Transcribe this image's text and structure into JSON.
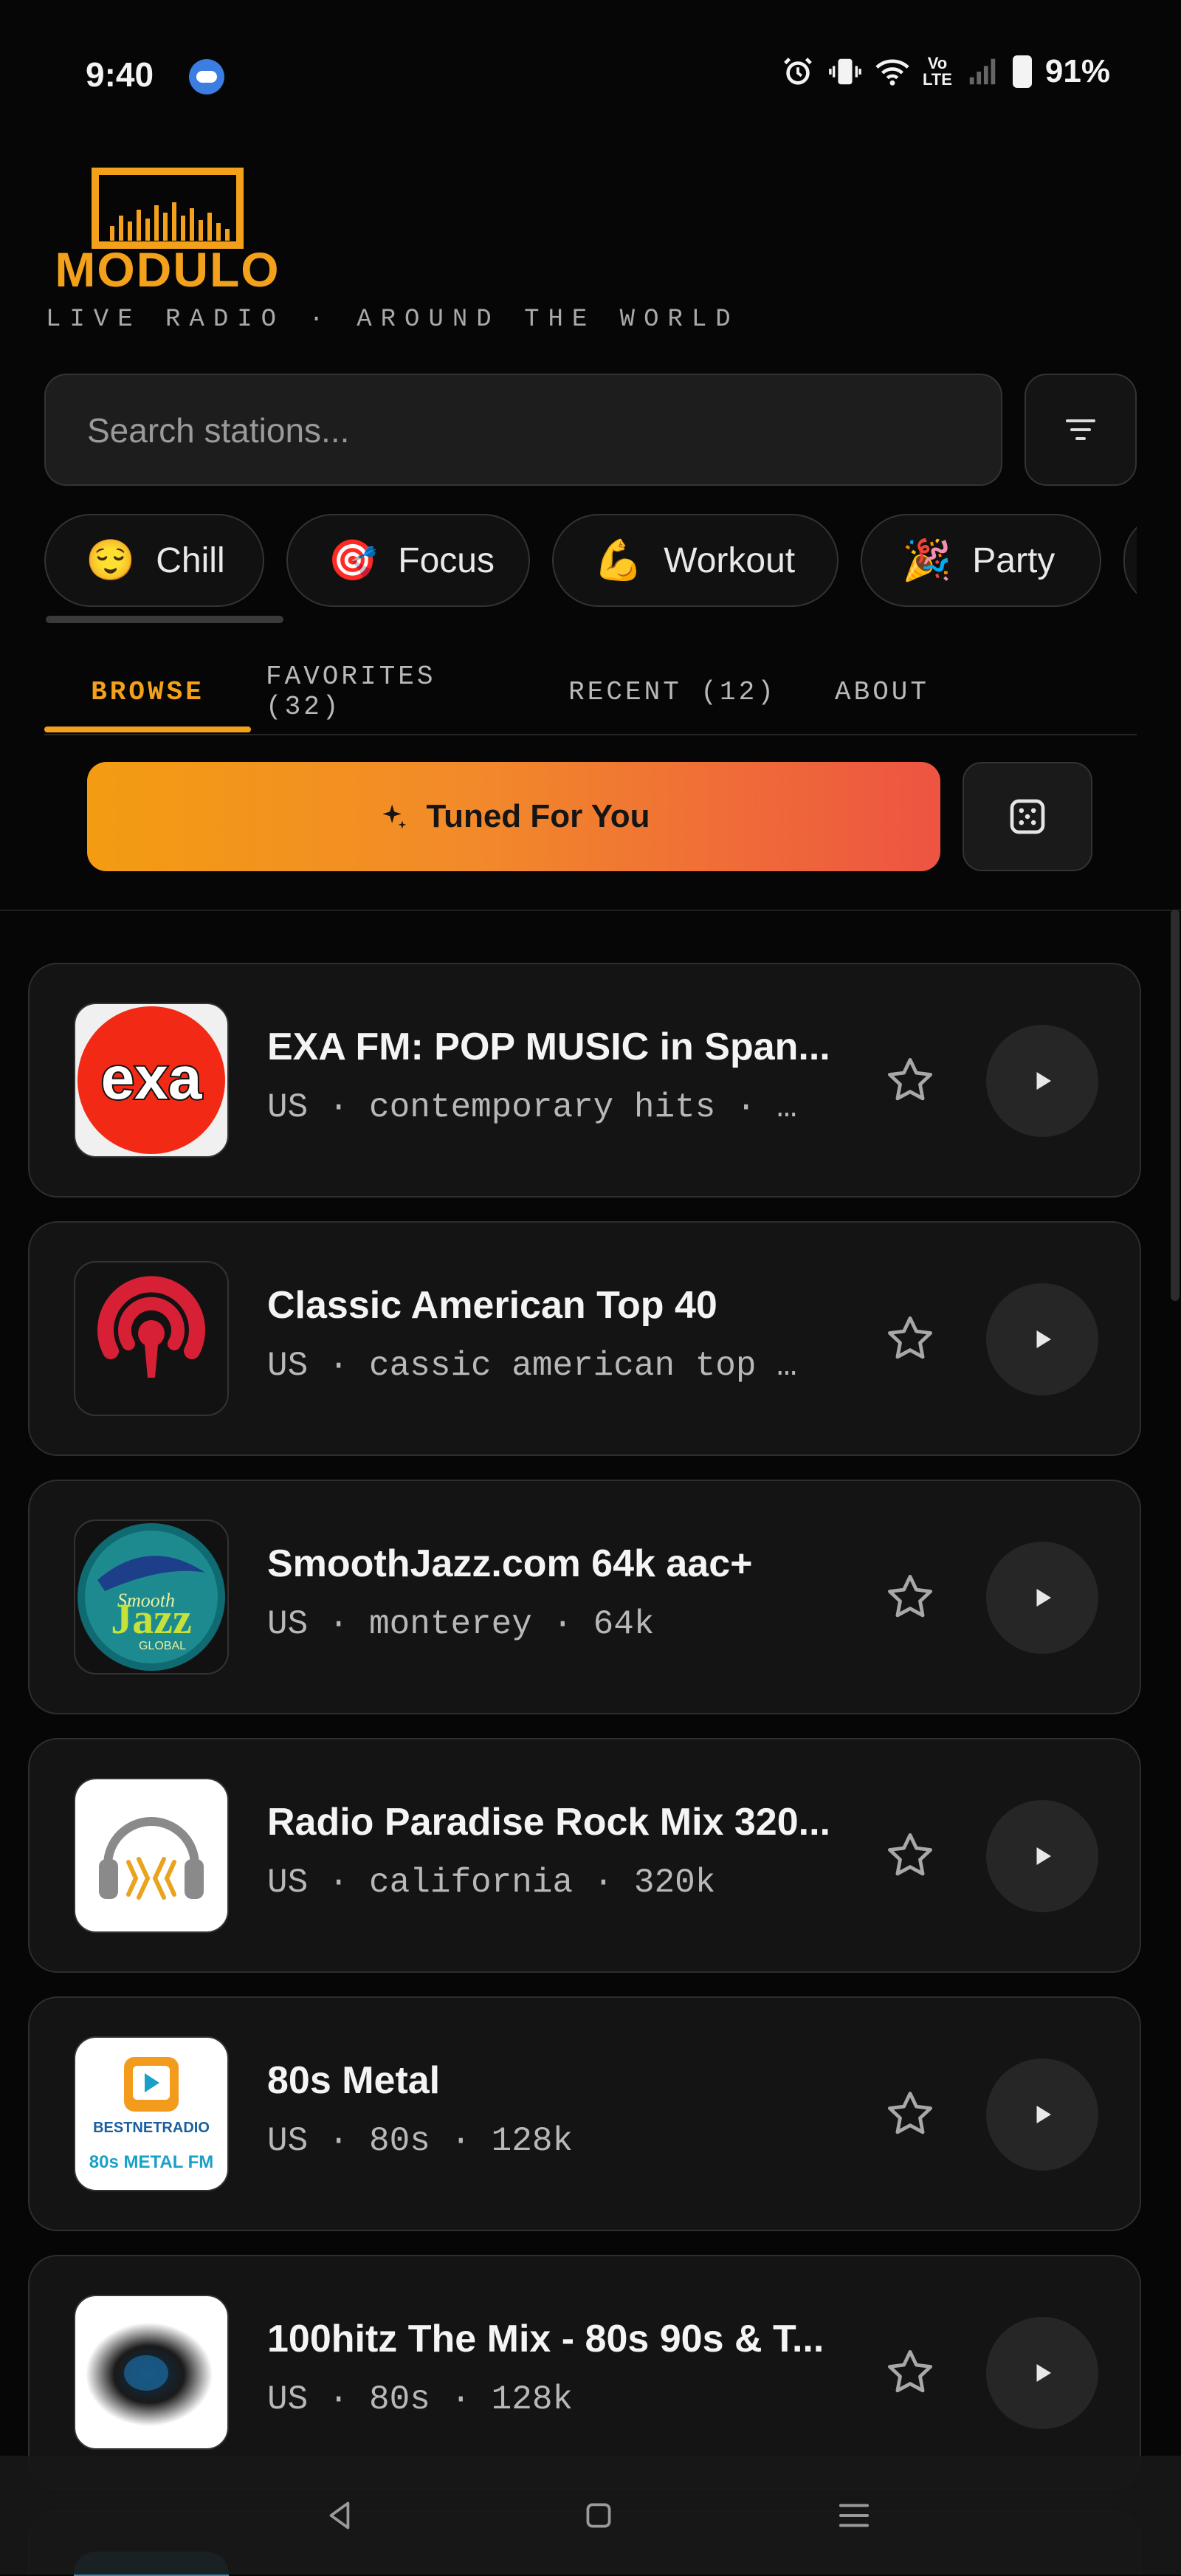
{
  "status_bar": {
    "time": "9:40",
    "battery": "91%",
    "lte_label_top": "Vo",
    "lte_label_bottom": "LTE"
  },
  "brand": {
    "logo_text": "MODULO",
    "tagline": "LIVE RADIO · AROUND THE WORLD",
    "accent_color": "#f3a11b"
  },
  "search": {
    "placeholder": "Search stations...",
    "value": ""
  },
  "moods": [
    {
      "emoji": "😌",
      "label": "Chill"
    },
    {
      "emoji": "🎯",
      "label": "Focus"
    },
    {
      "emoji": "💪",
      "label": "Workout"
    },
    {
      "emoji": "🎉",
      "label": "Party"
    }
  ],
  "tabs": [
    {
      "label": "BROWSE",
      "active": true
    },
    {
      "label": "FAVORITES (32)",
      "active": false
    },
    {
      "label": "RECENT (12)",
      "active": false
    },
    {
      "label": "ABOUT",
      "active": false
    }
  ],
  "tuned": {
    "label": "Tuned For You",
    "icon": "sparkle-icon"
  },
  "stations": [
    {
      "name": "EXA FM: POP MUSIC in Span...",
      "meta": "US · contemporary hits · …",
      "logo": "exa"
    },
    {
      "name": "Classic American Top 40",
      "meta": "US · cassic american top …",
      "logo": "iheart"
    },
    {
      "name": "SmoothJazz.com 64k aac+",
      "meta": "US · monterey · 64k",
      "logo": "smoothjazz",
      "logo_text": [
        "Smooth",
        "Jazz",
        "GLOBAL"
      ]
    },
    {
      "name": "Radio Paradise Rock Mix 320...",
      "meta": "US · california · 320k",
      "logo": "headphones"
    },
    {
      "name": "80s Metal",
      "meta": "US · 80s · 128k",
      "logo": "bestnet",
      "logo_text": [
        "BESTNETRADIO",
        "80s METAL FM"
      ]
    },
    {
      "name": "100hitz The Mix - 80s 90s & T...",
      "meta": "US · 80s · 128k",
      "logo": "blurred"
    }
  ]
}
